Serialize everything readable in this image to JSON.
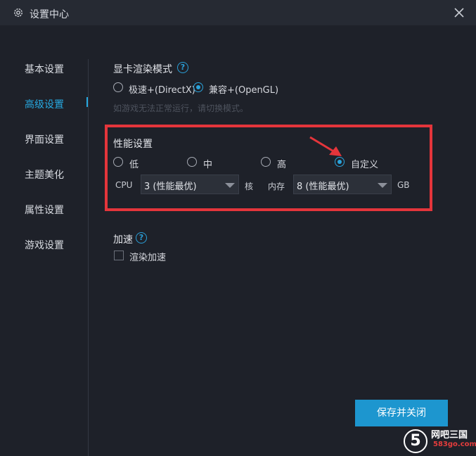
{
  "window": {
    "title": "设置中心"
  },
  "sidebar": {
    "items": [
      {
        "label": "基本设置",
        "active": false
      },
      {
        "label": "高级设置",
        "active": true
      },
      {
        "label": "界面设置",
        "active": false
      },
      {
        "label": "主题美化",
        "active": false
      },
      {
        "label": "属性设置",
        "active": false
      },
      {
        "label": "游戏设置",
        "active": false
      }
    ]
  },
  "render_mode": {
    "title": "显卡渲染模式",
    "options": [
      "极速+(DirectX)",
      "兼容+(OpenGL)"
    ],
    "selected": "兼容+(OpenGL)",
    "hint": "如游戏无法正常运行，请切换模式。"
  },
  "performance": {
    "title": "性能设置",
    "options": [
      "低",
      "中",
      "高",
      "自定义"
    ],
    "selected": "自定义",
    "cpu_label": "CPU",
    "cpu_value": "3 (性能最优)",
    "cpu_unit": "核",
    "memory_label": "内存",
    "memory_value": "8 (性能最优)",
    "memory_unit": "GB"
  },
  "acceleration": {
    "title": "加速",
    "checkbox_label": "渲染加速",
    "checked": false
  },
  "footer": {
    "save_label": "保存并关闭"
  },
  "watermark": {
    "logo_char": "5",
    "name": "网吧三国",
    "url": "583go.com"
  },
  "colors": {
    "accent": "#27a9e1",
    "highlight_box": "#e4353b",
    "background": "#1e2129"
  }
}
